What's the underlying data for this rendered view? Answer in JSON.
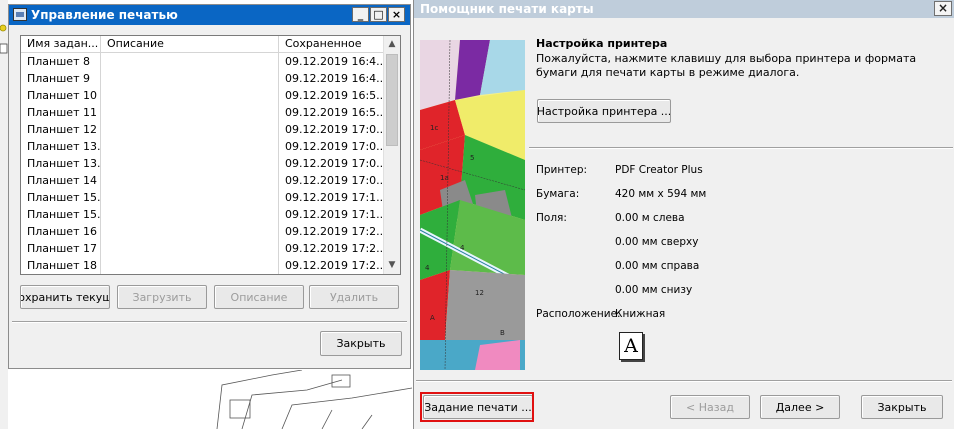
{
  "print_manager": {
    "title": "Управление печатью",
    "window_buttons": {
      "minimize": "_",
      "maximize": "□",
      "close": "×"
    },
    "columns": [
      "Имя задан...",
      "Описание",
      "Сохраненное"
    ],
    "rows": [
      {
        "name": "Планшет 8",
        "description": "",
        "saved": "09.12.2019 16:4..."
      },
      {
        "name": "Планшет 9",
        "description": "",
        "saved": "09.12.2019 16:4..."
      },
      {
        "name": "Планшет 10",
        "description": "",
        "saved": "09.12.2019 16:5..."
      },
      {
        "name": "Планшет 11",
        "description": "",
        "saved": "09.12.2019 16:5..."
      },
      {
        "name": "Планшет 12",
        "description": "",
        "saved": "09.12.2019 17:0..."
      },
      {
        "name": "Планшет 13...",
        "description": "",
        "saved": "09.12.2019 17:0..."
      },
      {
        "name": "Планшет 13...",
        "description": "",
        "saved": "09.12.2019 17:0..."
      },
      {
        "name": "Планшет 14",
        "description": "",
        "saved": "09.12.2019 17:0..."
      },
      {
        "name": "Планшет 15...",
        "description": "",
        "saved": "09.12.2019 17:1..."
      },
      {
        "name": "Планшет 15...",
        "description": "",
        "saved": "09.12.2019 17:1..."
      },
      {
        "name": "Планшет 16",
        "description": "",
        "saved": "09.12.2019 17:2..."
      },
      {
        "name": "Планшет 17",
        "description": "",
        "saved": "09.12.2019 17:2..."
      },
      {
        "name": "Планшет 18",
        "description": "",
        "saved": "09.12.2019 17:2..."
      }
    ],
    "buttons": {
      "save_current": "Сохранить текуще",
      "load": "Загрузить",
      "description": "Описание",
      "delete": "Удалить",
      "close": "Закрыть"
    }
  },
  "wizard": {
    "title": "Помощник печати карты",
    "close_glyph": "×",
    "heading": "Настройка принтера",
    "description": "Пожалуйста, нажмите клавишу для выбора принтера и формата бумаги для печати карты в режиме диалога.",
    "printer_setup_button": "Настройка принтера ...",
    "printer_label": "Принтер:",
    "printer_value": "PDF Creator Plus",
    "paper_label": "Бумага:",
    "paper_value": "420 мм x 594 мм",
    "margins_label": "Поля:",
    "margin_left": "0.00 м слева",
    "margin_top": "0.00 мм сверху",
    "margin_right": "0.00 мм справа",
    "margin_bottom": "0.00 мм снизу",
    "orientation_label": "Расположение:",
    "orientation_value": "Книжная",
    "orientation_icon_glyph": "A",
    "footer_buttons": {
      "print_job": "Задание печати ...",
      "back": "< Назад",
      "next": "Далее >",
      "close": "Закрыть"
    }
  },
  "colors": {
    "active_titlebar": "#0a66c4",
    "inactive_titlebar": "#bfcddb",
    "highlight_border": "#e01010"
  }
}
